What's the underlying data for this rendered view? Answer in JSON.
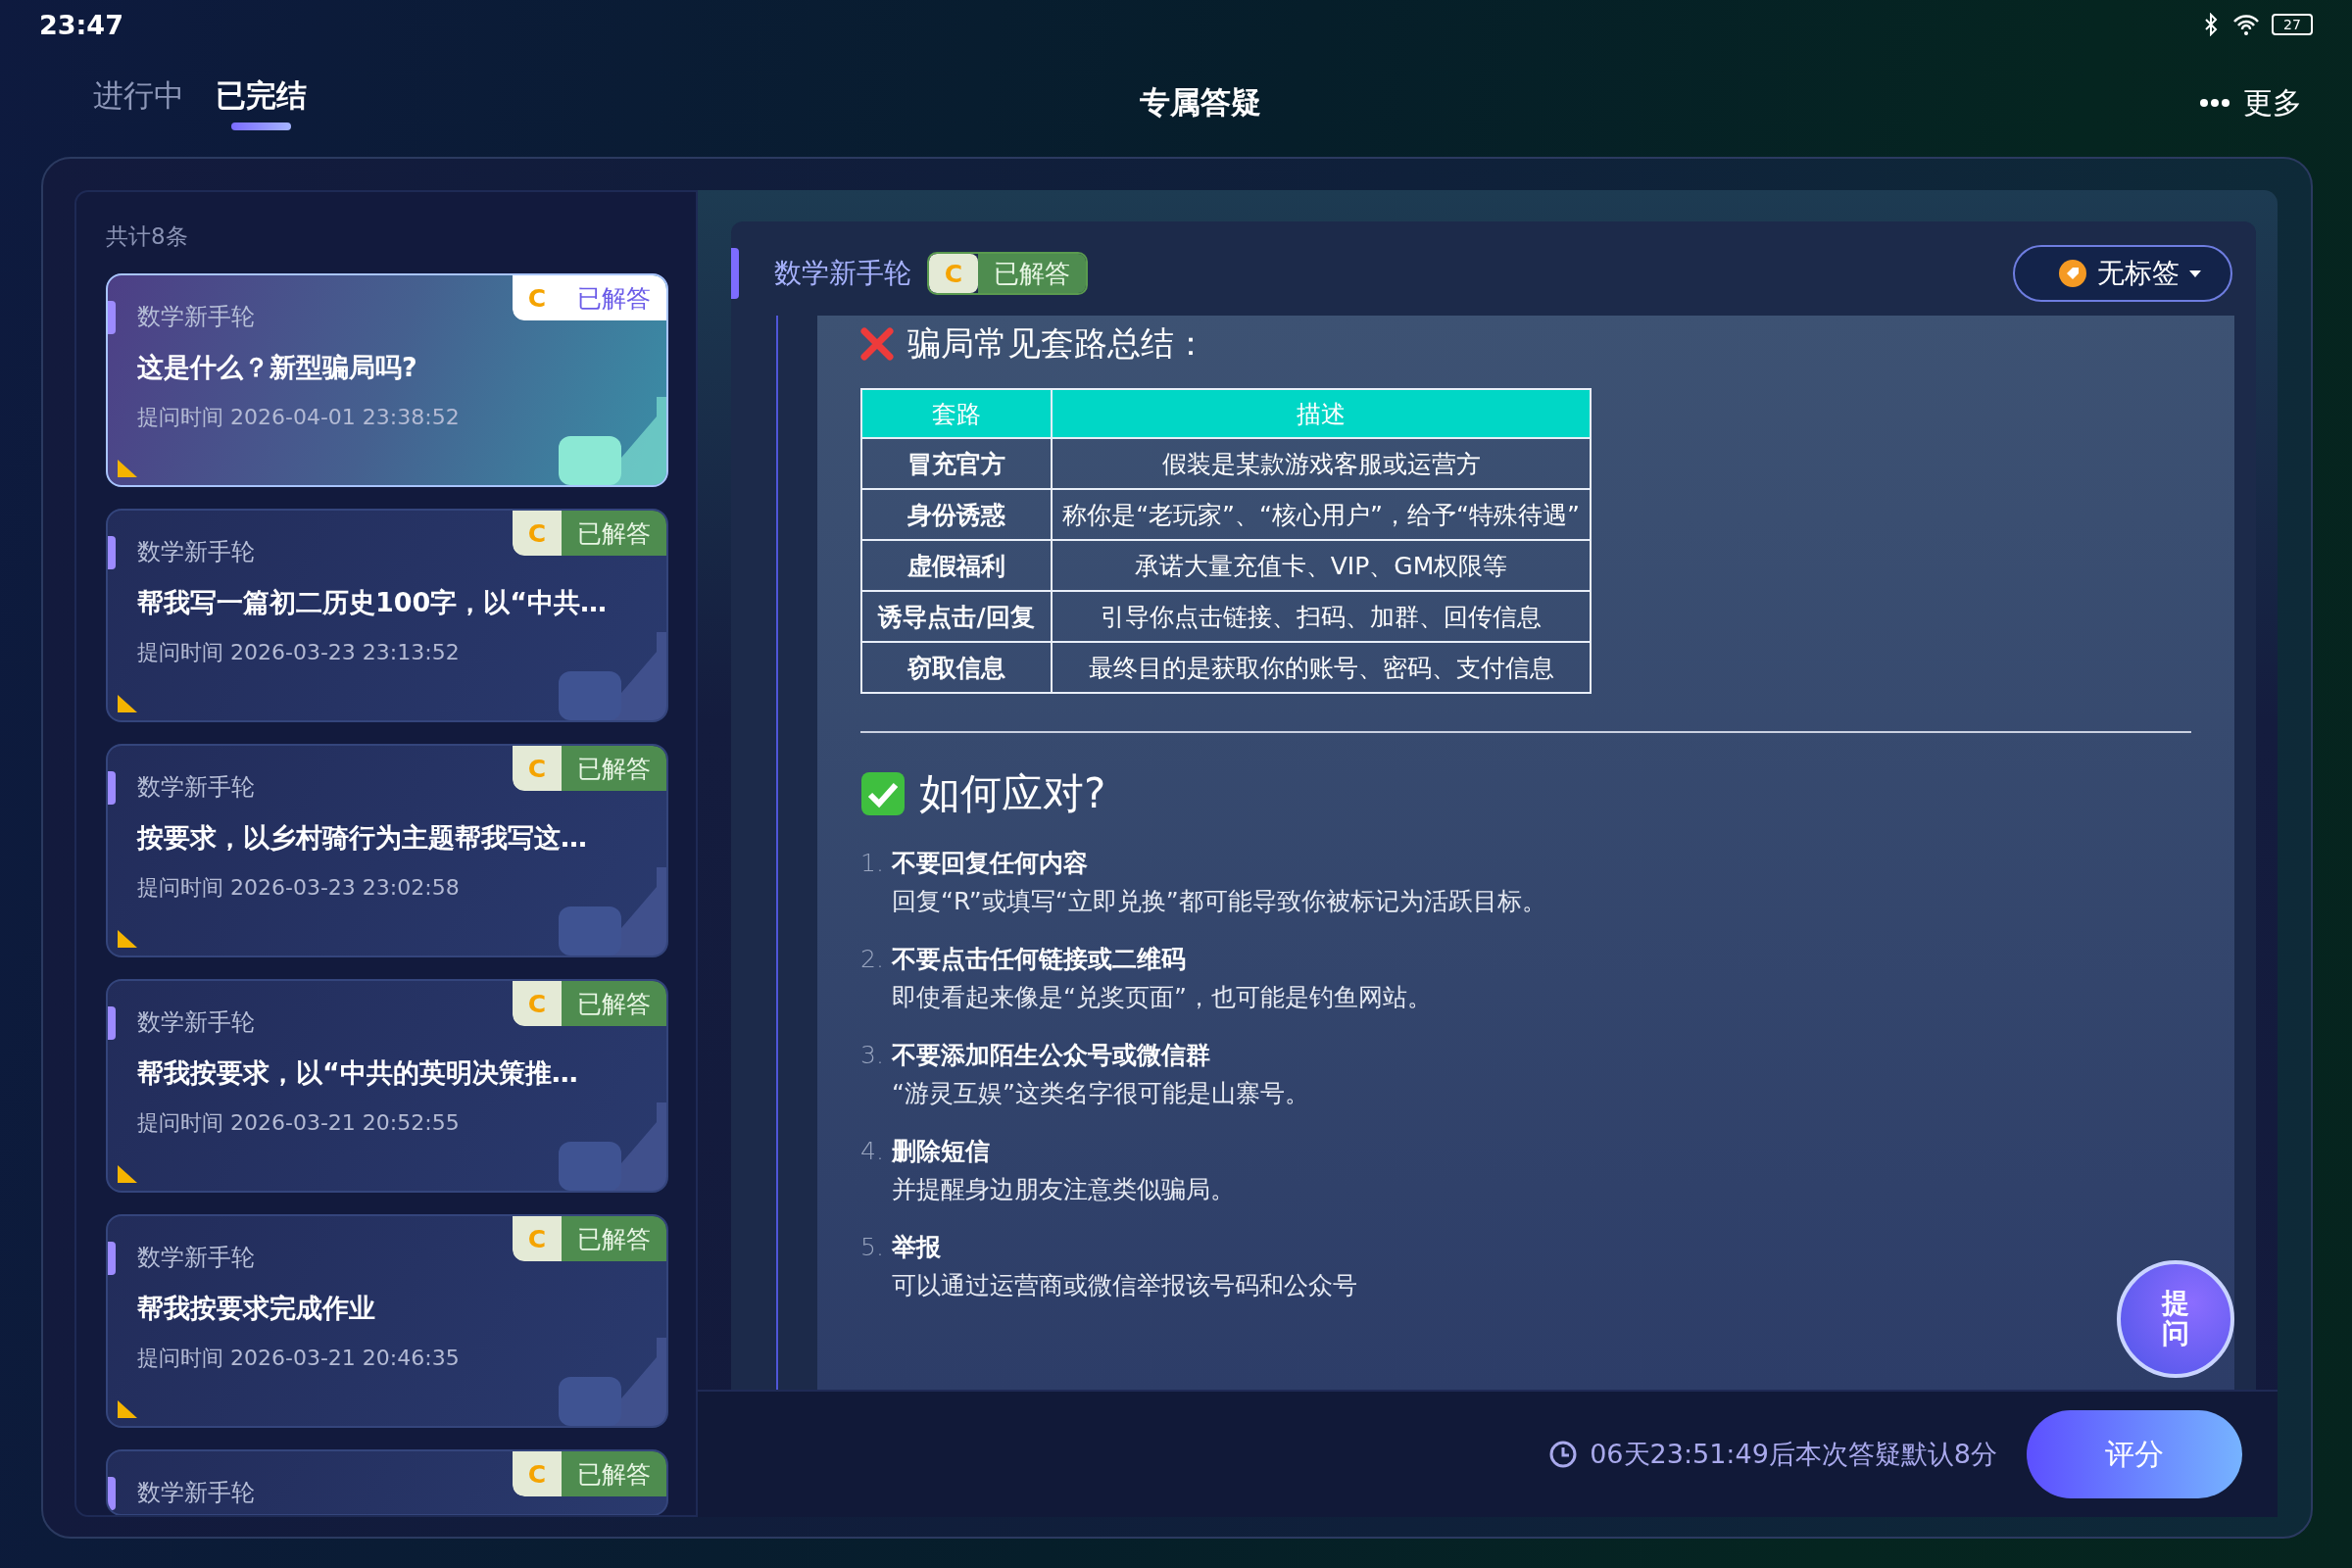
{
  "status_bar": {
    "time": "23:47",
    "battery": "27"
  },
  "tabs": [
    {
      "label": "进行中",
      "selected": false
    },
    {
      "label": "已完结",
      "selected": true
    }
  ],
  "title": "专属答疑",
  "more": {
    "label": "更多"
  },
  "list": {
    "count": "共计8条",
    "items": [
      {
        "category": "数学新手轮",
        "grade": "C",
        "status": "已解答",
        "title": "这是什么？新型骗局吗?",
        "time": "提问时间 2026-04-01 23:38:52",
        "selected": true
      },
      {
        "category": "数学新手轮",
        "grade": "C",
        "status": "已解答",
        "title": "帮我写一篇初二历史100字，以“中共…",
        "time": "提问时间 2026-03-23 23:13:52",
        "selected": false
      },
      {
        "category": "数学新手轮",
        "grade": "C",
        "status": "已解答",
        "title": "按要求，以乡村骑行为主题帮我写这…",
        "time": "提问时间 2026-03-23 23:02:58",
        "selected": false
      },
      {
        "category": "数学新手轮",
        "grade": "C",
        "status": "已解答",
        "title": "帮我按要求，以“中共的英明决策推…",
        "time": "提问时间 2026-03-21 20:52:55",
        "selected": false
      },
      {
        "category": "数学新手轮",
        "grade": "C",
        "status": "已解答",
        "title": "帮我按要求完成作业",
        "time": "提问时间 2026-03-21 20:46:35",
        "selected": false
      },
      {
        "category": "数学新手轮",
        "grade": "C",
        "status": "已解答",
        "selected": false
      }
    ]
  },
  "detail": {
    "category": "数学新手轮",
    "grade": "C",
    "status": "已解答",
    "tag": "无标签",
    "heading": "骗局常见套路总结：",
    "table": {
      "columns": [
        "套路",
        "描述"
      ],
      "rows": [
        [
          "冒充官方",
          "假装是某款游戏客服或运营方"
        ],
        [
          "身份诱惑",
          "称你是“老玩家”、“核心用户”，给予“特殊待遇”"
        ],
        [
          "虚假福利",
          "承诺大量充值卡、VIP、GM权限等"
        ],
        [
          "诱导点击/回复",
          "引导你点击链接、扫码、加群、回传信息"
        ],
        [
          "窃取信息",
          "最终目的是获取你的账号、密码、支付信息"
        ]
      ]
    },
    "heading2": "如何应对?",
    "steps": [
      {
        "number": "1.",
        "title": "不要回复任何内容",
        "text": "回复“R”或填写“立即兑换”都可能导致你被标记为活跃目标。"
      },
      {
        "number": "2.",
        "title": "不要点击任何链接或二维码",
        "text": "即使看起来像是“兑奖页面”，也可能是钓鱼网站。"
      },
      {
        "number": "3.",
        "title": "不要添加陌生公众号或微信群",
        "text": "“游灵互娱”这类名字很可能是山寨号。"
      },
      {
        "number": "4.",
        "title": "删除短信",
        "text": "并提醒身边朋友注意类似骗局。"
      },
      {
        "number": "5.",
        "title": "举报",
        "text": "可以通过运营商或微信举报该号码和公众号"
      }
    ]
  },
  "ask_button": {
    "label": "提问"
  },
  "footer": {
    "countdown": "06天23:51:49后本次答疑默认8分",
    "button": "评分"
  }
}
